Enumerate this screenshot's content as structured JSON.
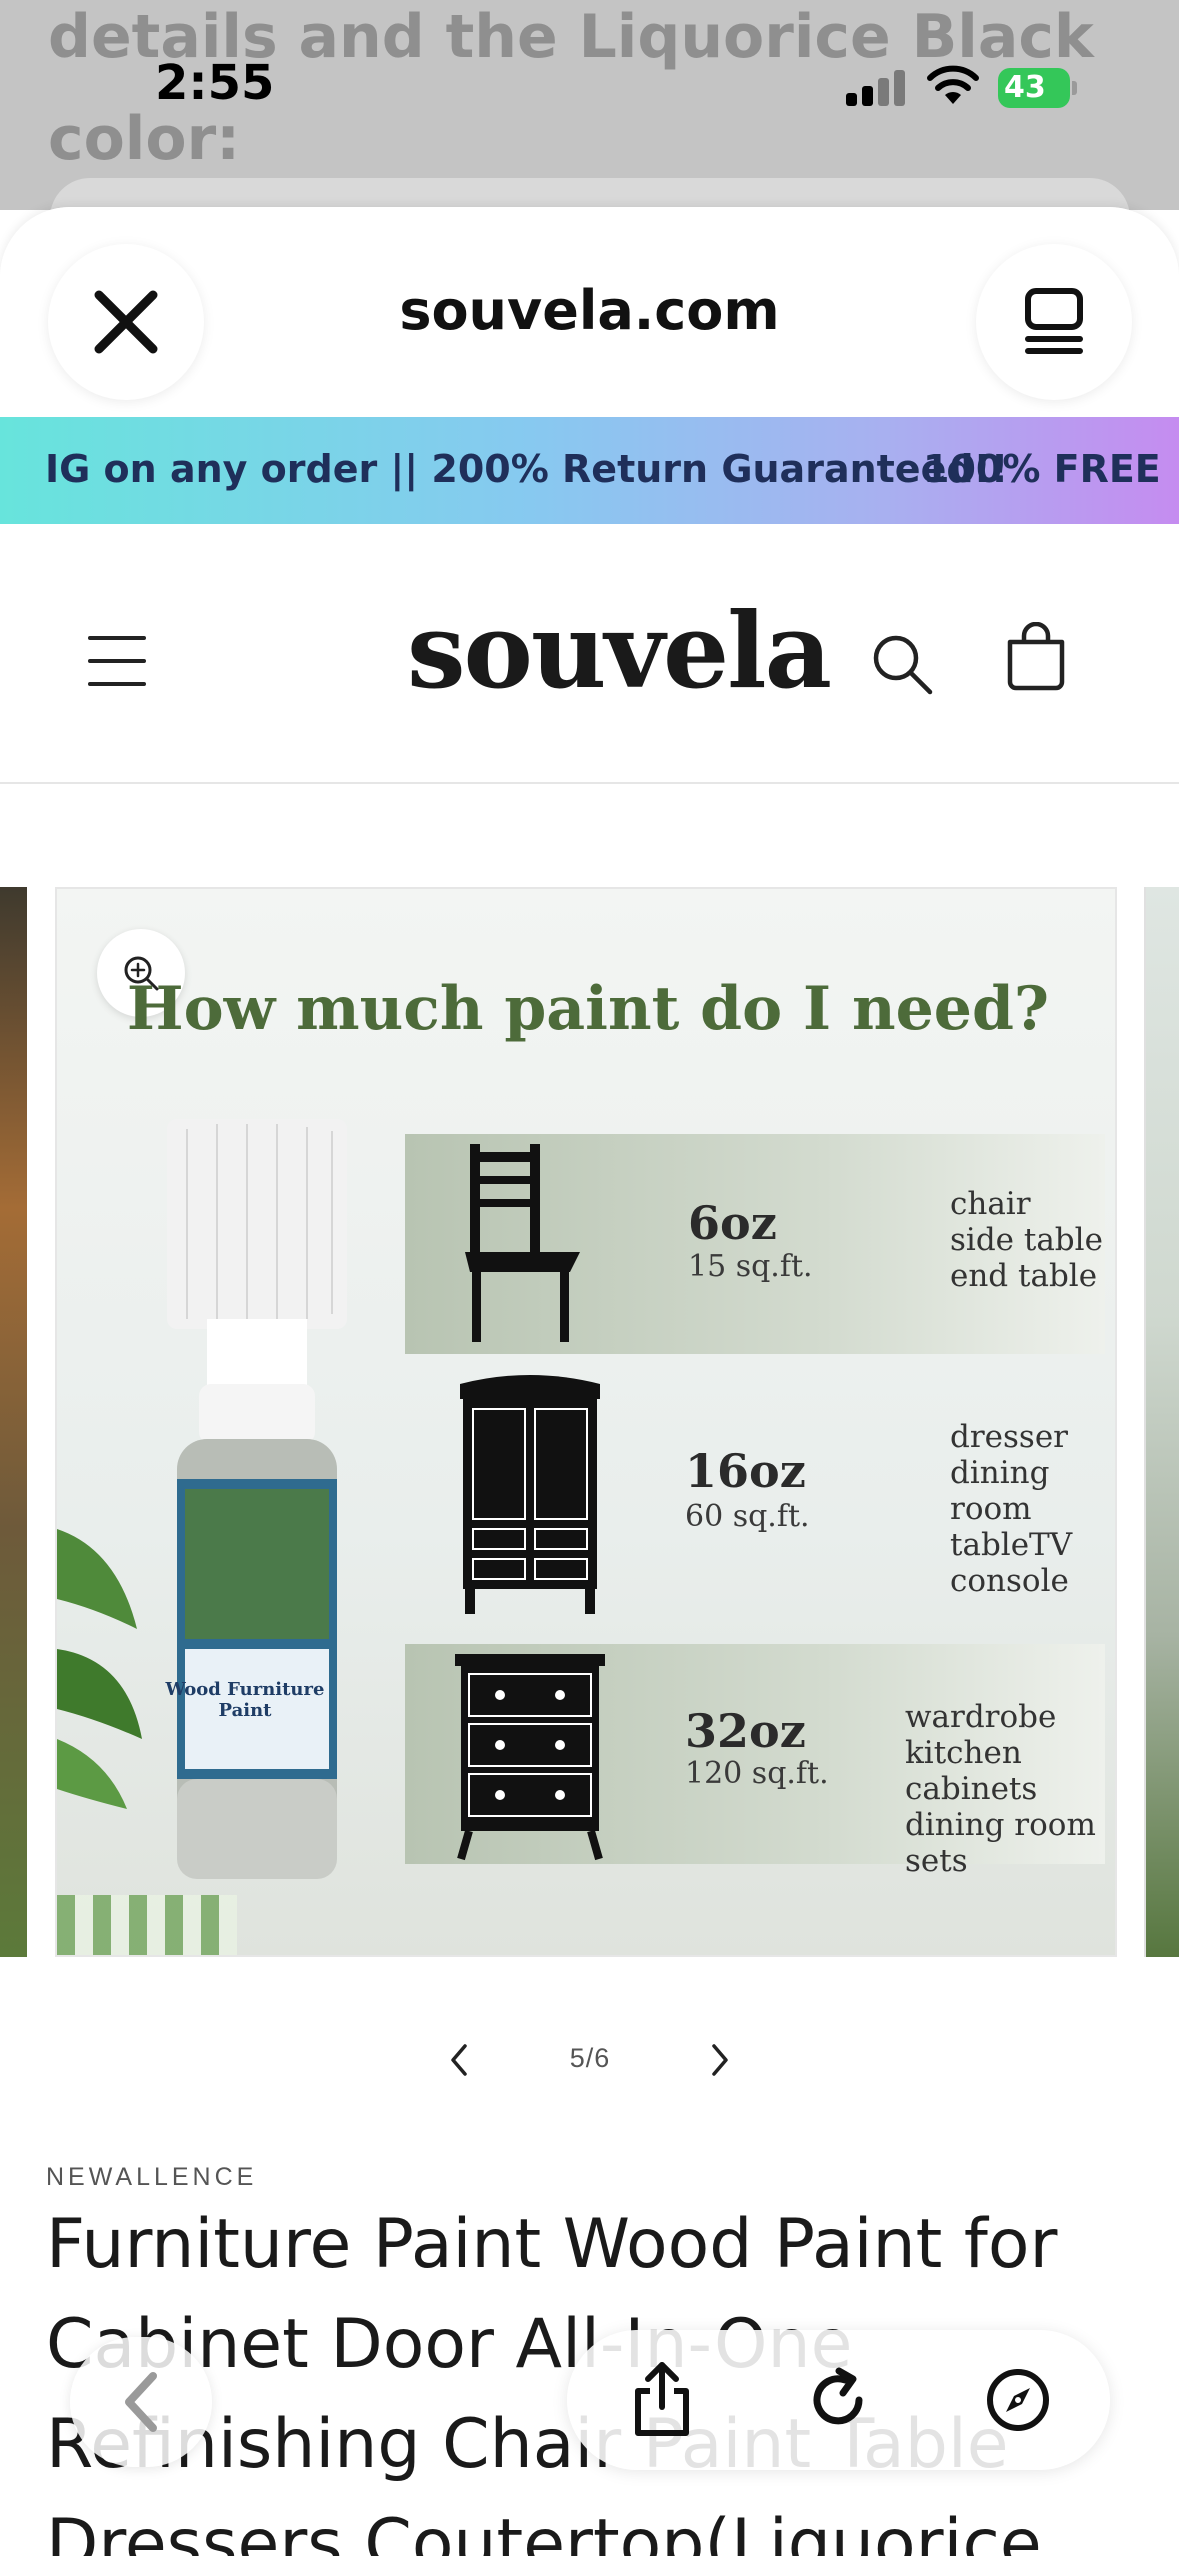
{
  "background_page": {
    "text_lines": [
      "details and the ",
      "Liquorice Black",
      "color:"
    ]
  },
  "status_bar": {
    "time": "2:55",
    "battery_level": "43"
  },
  "browser": {
    "domain": "souvela.com",
    "close_icon": "close-icon",
    "tabs_icon": "tabs-icon"
  },
  "announcement": {
    "text_1": "IG on any order || 200% Return Guaranteed!!",
    "text_2": "100% FREE"
  },
  "site_header": {
    "logo": "souvela",
    "menu_icon": "hamburger-menu-icon",
    "search_icon": "search-icon",
    "cart_icon": "cart-icon"
  },
  "product_image": {
    "title": "How much paint do I need?",
    "tiers": [
      {
        "amount": "6oz",
        "area": "15 sq.ft.",
        "uses": "chair\nside table\nend table"
      },
      {
        "amount": "16oz",
        "area": "60 sq.ft.",
        "uses": "dresser\ndining room\ntableTV\nconsole"
      },
      {
        "amount": "32oz",
        "area": "120 sq.ft.",
        "uses": "wardrobe\nkitchen cabinets\ndining room sets"
      }
    ],
    "bottle_label": "Wood Furniture Paint"
  },
  "pager": {
    "current": "5/6"
  },
  "product": {
    "vendor": "NEWALLENCE",
    "title": "Furniture Paint Wood Paint for Cabinet Door All-In-One Refinishing Chair Paint Table Dressers Coutertop(Liquorice"
  },
  "colors": {
    "accent_gradient_start": "#67e4dc",
    "accent_gradient_end": "#c58cf0",
    "image_green": "#4d6b3a"
  }
}
